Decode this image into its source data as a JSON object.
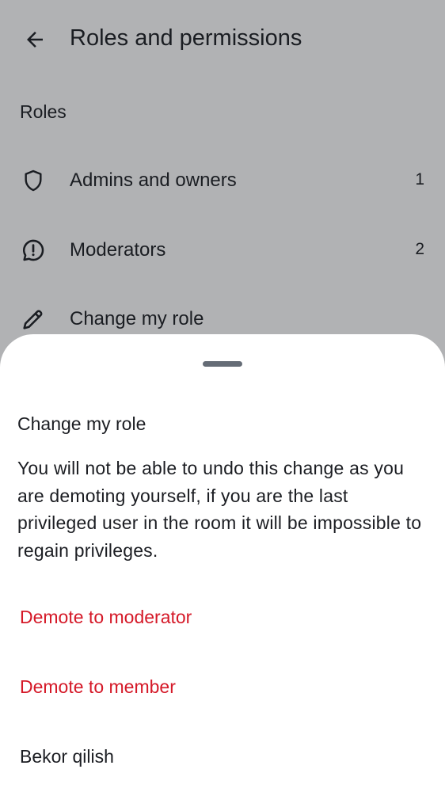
{
  "header": {
    "title": "Roles and permissions",
    "back_icon": "arrow-left-icon"
  },
  "roles": {
    "section_title": "Roles",
    "items": [
      {
        "label": "Admins and owners",
        "count": "1",
        "icon": "shield-icon"
      },
      {
        "label": "Moderators",
        "count": "2",
        "icon": "chat-alert-icon"
      },
      {
        "label": "Change my role",
        "icon": "pencil-icon"
      }
    ]
  },
  "sheet": {
    "title": "Change my role",
    "message": "You will not be able to undo this change as you are demoting yourself, if you are the last privileged user in the room it will be impossible to regain privileges.",
    "actions": {
      "demote_moderator": "Demote to moderator",
      "demote_member": "Demote to member",
      "cancel": "Bekor qilish"
    }
  },
  "colors": {
    "danger": "#d51928",
    "text": "#1b1d22",
    "scrim": "rgba(27,29,34,0.34)"
  }
}
